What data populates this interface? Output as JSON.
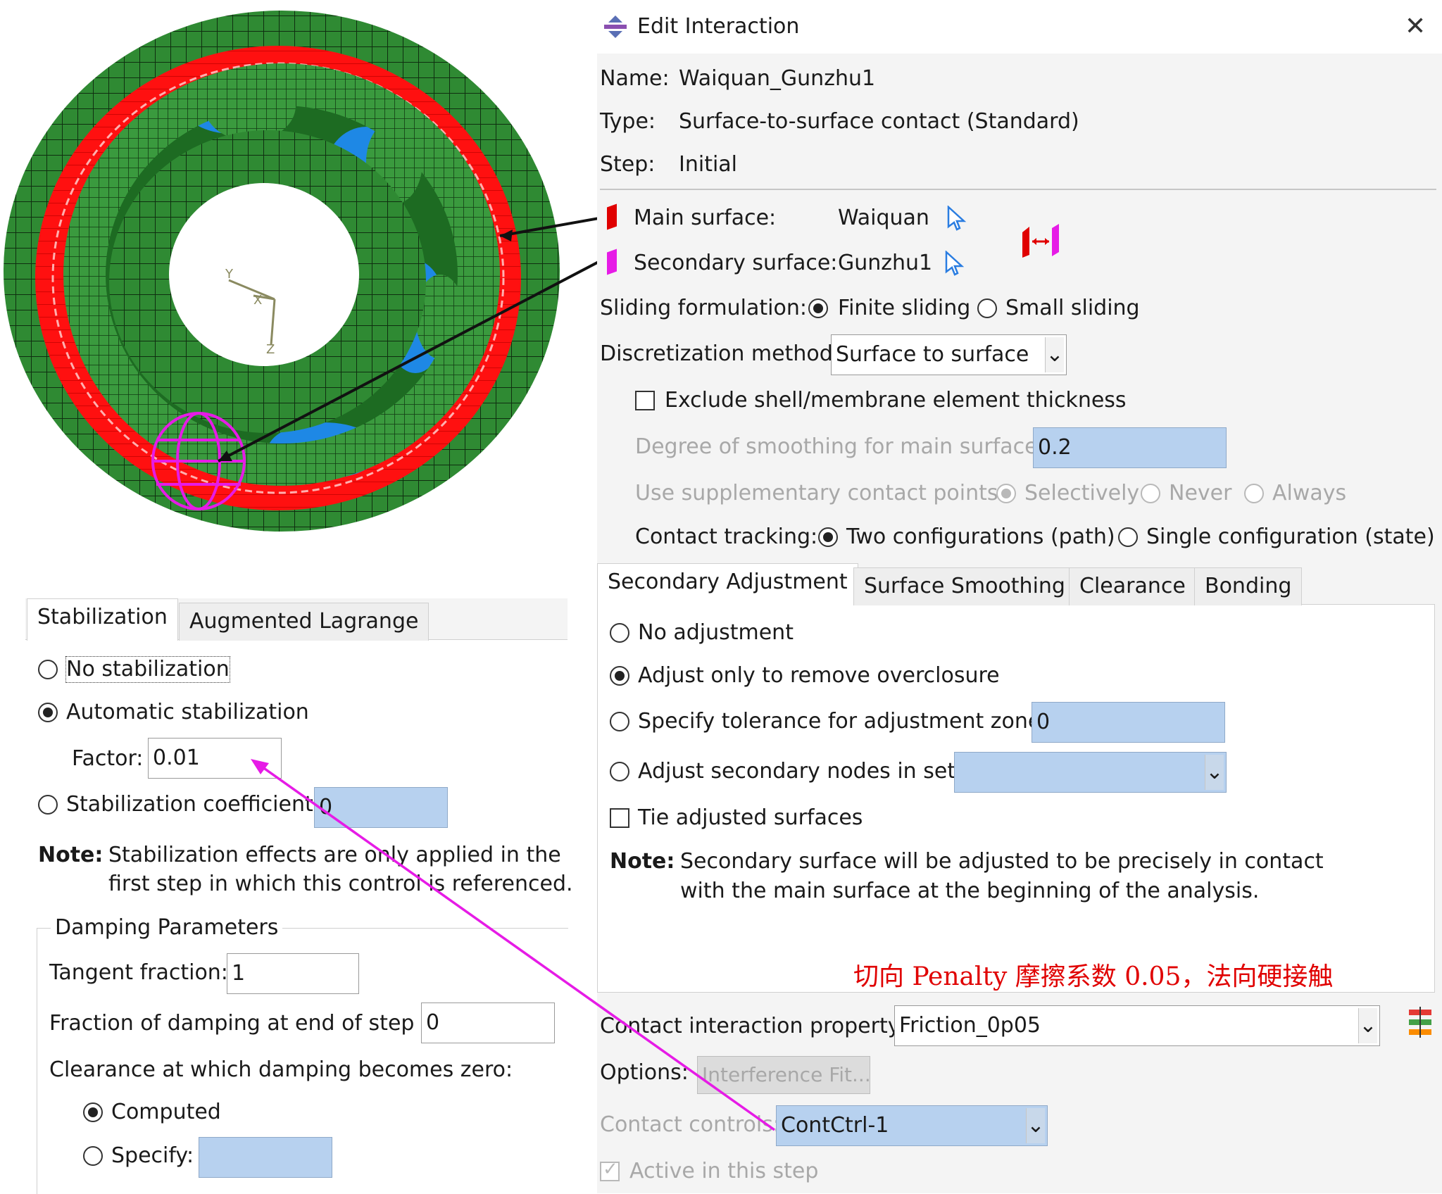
{
  "dialog": {
    "title": "Edit Interaction",
    "name_label": "Name:",
    "name_value": "Waiquan_Gunzhu1",
    "type_label": "Type:",
    "type_value": "Surface-to-surface contact (Standard)",
    "step_label": "Step:",
    "step_value": "Initial",
    "main_surface_label": "Main surface:",
    "main_surface_value": "Waiquan",
    "secondary_surface_label": "Secondary surface:",
    "secondary_surface_value": "Gunzhu1",
    "sliding_label": "Sliding formulation:",
    "sliding_options": [
      "Finite sliding",
      "Small sliding"
    ],
    "sliding_selected": "Finite sliding",
    "discretization_label": "Discretization method:",
    "discretization_value": "Surface to surface",
    "exclude_label": "Exclude shell/membrane element thickness",
    "smoothing_label": "Degree of smoothing for main surface:",
    "smoothing_value": "0.2",
    "supplementary_label": "Use supplementary contact points:",
    "supplementary_options": [
      "Selectively",
      "Never",
      "Always"
    ],
    "tracking_label": "Contact tracking:",
    "tracking_options": [
      "Two configurations (path)",
      "Single configuration (state)"
    ],
    "tabs": [
      "Secondary Adjustment",
      "Surface Smoothing",
      "Clearance",
      "Bonding"
    ],
    "adjust_options": [
      "No adjustment",
      "Adjust only to remove overclosure",
      "Specify tolerance for adjustment zone:",
      "Adjust secondary nodes in set:"
    ],
    "adjust_selected": "Adjust only to remove overclosure",
    "tolerance_value": "0",
    "tie_label": "Tie adjusted surfaces",
    "note_label": "Note:",
    "note_line1": "Secondary surface will be adjusted to be precisely in contact",
    "note_line2": "with the main surface at the beginning of the analysis.",
    "property_label": "Contact interaction property:",
    "property_value": "Friction_0p05",
    "options_label": "Options:",
    "options_button": "Interference Fit...",
    "controls_label": "Contact controls:",
    "controls_value": "ContCtrl-1",
    "active_label": "Active in this step"
  },
  "annotation": {
    "text": "切向 Penalty 摩擦系数 0.05，法向硬接触",
    "color": "#e00000"
  },
  "stabilization": {
    "tabs": [
      "Stabilization",
      "Augmented Lagrange"
    ],
    "no_stab": "No stabilization",
    "auto_stab": "Automatic stabilization",
    "factor_label": "Factor:",
    "factor_value": "0.01",
    "coef_label": "Stabilization coefficient:",
    "coef_value": "0",
    "note_label": "Note:",
    "note_line1": "Stabilization effects are only applied in the",
    "note_line2": "first step in which this control is referenced.",
    "damping_title": "Damping Parameters",
    "tangent_label": "Tangent fraction:",
    "tangent_value": "1",
    "fraction_label": "Fraction of damping at end of step :",
    "fraction_value": "0",
    "clearance_label": "Clearance at which damping becomes zero:",
    "computed_label": "Computed",
    "specify_label": "Specify:"
  },
  "model": {
    "axis_labels": [
      "Y",
      "X",
      "Z"
    ],
    "colors": {
      "mesh": "#2e7d32",
      "surface": "#ff1a1a",
      "roller": "#1e88e5",
      "secondary": "#e61be6"
    }
  }
}
